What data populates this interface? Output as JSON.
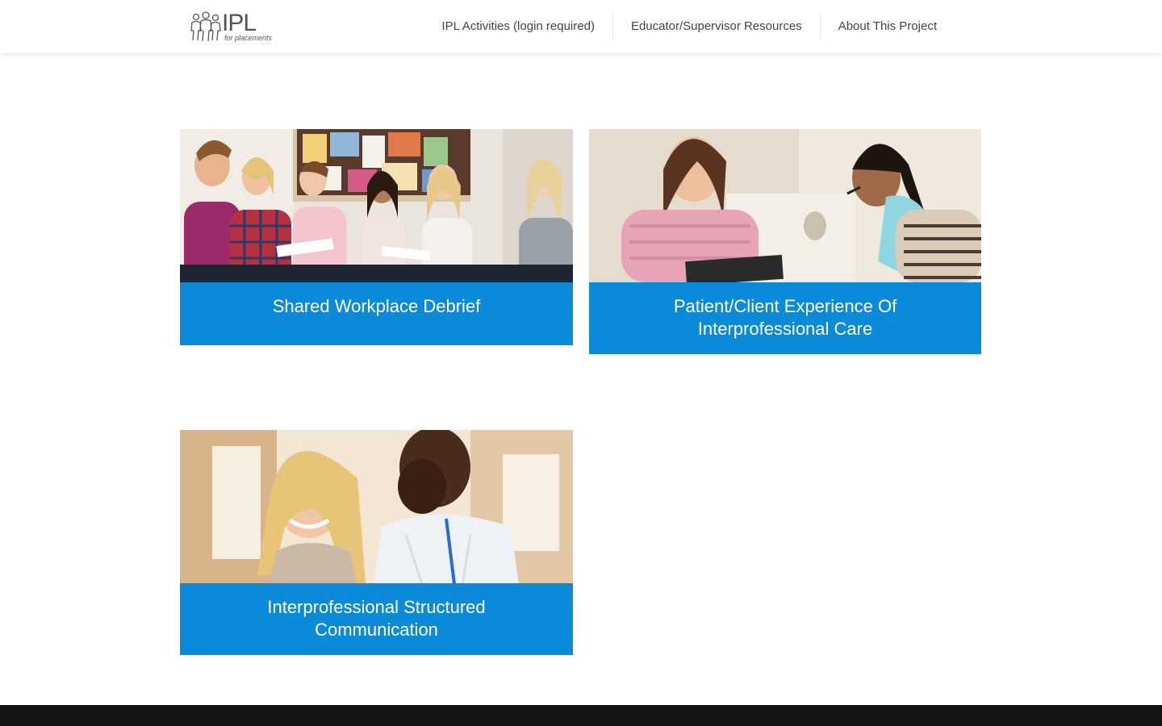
{
  "header": {
    "logo": {
      "title": "IPL",
      "subtitle": "for placements"
    },
    "nav": [
      {
        "label": "IPL Activities (login required)"
      },
      {
        "label": "Educator/Supervisor Resources"
      },
      {
        "label": "About This Project"
      }
    ]
  },
  "cards": [
    {
      "title": "Shared Workplace Debrief"
    },
    {
      "title": "Patient/Client Experience Of Interprofessional Care"
    },
    {
      "title": "Interprofessional Structured Communication"
    }
  ],
  "colors": {
    "caption_background": "#0a8ad9",
    "footer_background": "#141414"
  }
}
